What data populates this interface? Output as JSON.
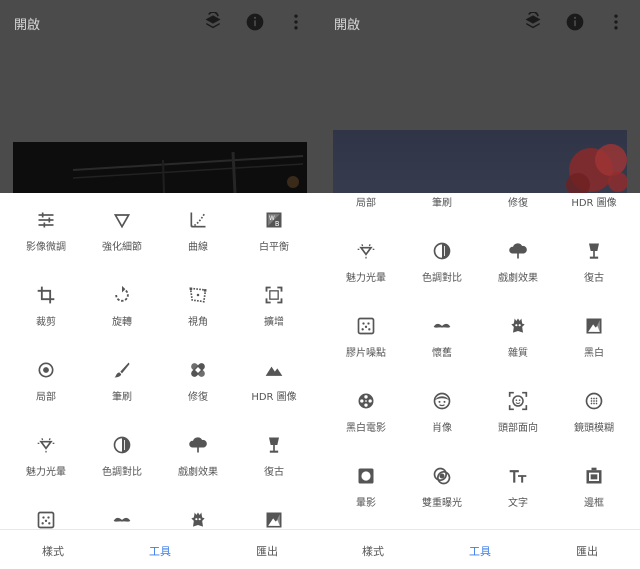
{
  "app": {
    "title": "開啟",
    "accent_color": "#3d7de6",
    "header_bg": "#4b4b4b"
  },
  "top_icons": [
    "layers-icon",
    "info-icon",
    "more-vert-icon"
  ],
  "bottom_tabs": [
    {
      "label": "樣式",
      "active": false
    },
    {
      "label": "工具",
      "active": true
    },
    {
      "label": "匯出",
      "active": false
    }
  ],
  "left_tools": [
    {
      "label": "影像微調",
      "icon": "tune-icon"
    },
    {
      "label": "強化細節",
      "icon": "details-icon"
    },
    {
      "label": "曲線",
      "icon": "curves-icon"
    },
    {
      "label": "白平衡",
      "icon": "white-balance-icon"
    },
    {
      "label": "裁剪",
      "icon": "crop-icon"
    },
    {
      "label": "旋轉",
      "icon": "rotate-icon"
    },
    {
      "label": "視角",
      "icon": "perspective-icon"
    },
    {
      "label": "擴增",
      "icon": "expand-icon"
    },
    {
      "label": "局部",
      "icon": "selective-icon"
    },
    {
      "label": "筆刷",
      "icon": "brush-icon"
    },
    {
      "label": "修復",
      "icon": "healing-icon"
    },
    {
      "label": "HDR 圖像",
      "icon": "hdr-icon"
    },
    {
      "label": "魅力光暈",
      "icon": "glamour-glow-icon"
    },
    {
      "label": "色調對比",
      "icon": "tonal-contrast-icon"
    },
    {
      "label": "戲劇效果",
      "icon": "drama-icon"
    },
    {
      "label": "復古",
      "icon": "vintage-icon"
    },
    {
      "label": "",
      "icon": "grainy-film-icon"
    },
    {
      "label": "",
      "icon": "retrolux-icon"
    },
    {
      "label": "",
      "icon": "grunge-icon"
    },
    {
      "label": "",
      "icon": "black-white-icon"
    }
  ],
  "right_tools": [
    {
      "label": "局部",
      "icon": "selective-icon"
    },
    {
      "label": "筆刷",
      "icon": "brush-icon"
    },
    {
      "label": "修復",
      "icon": "healing-icon"
    },
    {
      "label": "HDR 圖像",
      "icon": "hdr-icon"
    },
    {
      "label": "魅力光暈",
      "icon": "glamour-glow-icon"
    },
    {
      "label": "色調對比",
      "icon": "tonal-contrast-icon"
    },
    {
      "label": "戲劇效果",
      "icon": "drama-icon"
    },
    {
      "label": "復古",
      "icon": "vintage-icon"
    },
    {
      "label": "膠片噪點",
      "icon": "grainy-film-icon"
    },
    {
      "label": "懷舊",
      "icon": "retrolux-icon"
    },
    {
      "label": "雜質",
      "icon": "grunge-icon"
    },
    {
      "label": "黑白",
      "icon": "black-white-icon"
    },
    {
      "label": "黑白電影",
      "icon": "noir-icon"
    },
    {
      "label": "肖像",
      "icon": "portrait-icon"
    },
    {
      "label": "頭部面向",
      "icon": "head-pose-icon"
    },
    {
      "label": "鏡頭模糊",
      "icon": "lens-blur-icon"
    },
    {
      "label": "暈影",
      "icon": "vignette-icon"
    },
    {
      "label": "雙重曝光",
      "icon": "double-exposure-icon"
    },
    {
      "label": "文字",
      "icon": "text-icon"
    },
    {
      "label": "邊框",
      "icon": "frames-icon"
    }
  ]
}
